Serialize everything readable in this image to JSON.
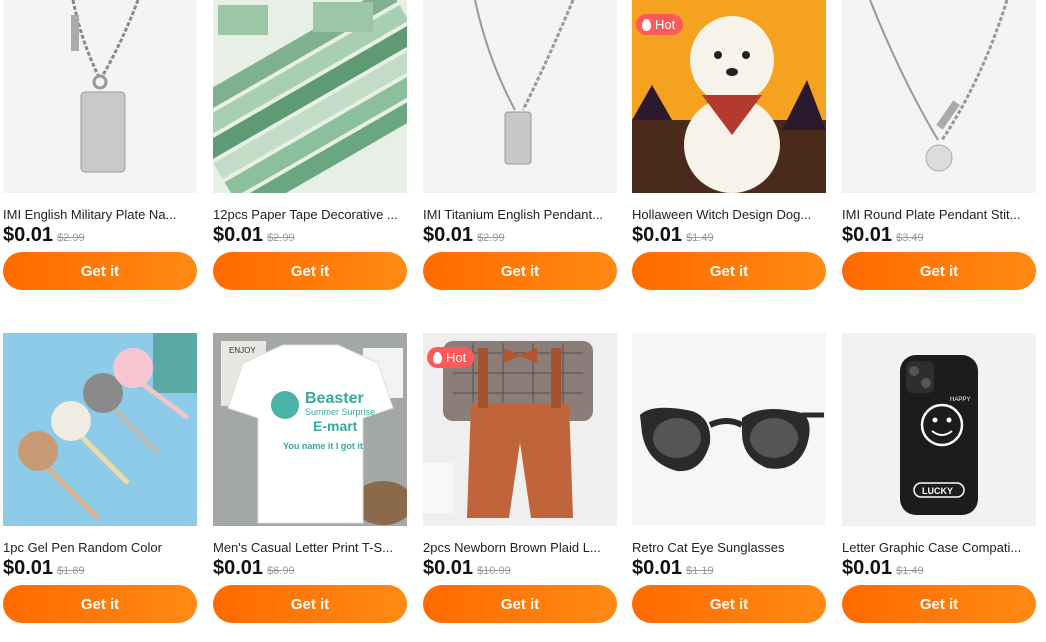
{
  "hot_label": "Hot",
  "products": [
    {
      "title": "IMI English Military Plate Na...",
      "price": "$0.01",
      "original_price": "$2.99",
      "button": "Get it",
      "hot": false,
      "image": "necklace-dog-tag"
    },
    {
      "title": "12pcs Paper Tape Decorative ...",
      "price": "$0.01",
      "original_price": "$2.99",
      "button": "Get it",
      "hot": false,
      "image": "washi-tape"
    },
    {
      "title": "IMI Titanium English Pendant...",
      "price": "$0.01",
      "original_price": "$2.99",
      "button": "Get it",
      "hot": false,
      "image": "necklace-pendant"
    },
    {
      "title": "Hollaween Witch Design Dog...",
      "price": "$0.01",
      "original_price": "$1.49",
      "button": "Get it",
      "hot": true,
      "image": "dog-bandana"
    },
    {
      "title": "IMI Round Plate Pendant Stit...",
      "price": "$0.01",
      "original_price": "$3.49",
      "button": "Get it",
      "hot": false,
      "image": "necklace-round"
    },
    {
      "title": "1pc Gel Pen Random Color",
      "price": "$0.01",
      "original_price": "$1.89",
      "button": "Get it",
      "hot": false,
      "image": "pom-pens"
    },
    {
      "title": "Men's Casual Letter Print T-S...",
      "price": "$0.01",
      "original_price": "$6.99",
      "button": "Get it",
      "hot": false,
      "image": "tshirt"
    },
    {
      "title": "2pcs Newborn Brown Plaid L...",
      "price": "$0.01",
      "original_price": "$10.99",
      "button": "Get it",
      "hot": true,
      "image": "baby-outfit"
    },
    {
      "title": "Retro Cat Eye Sunglasses",
      "price": "$0.01",
      "original_price": "$1.19",
      "button": "Get it",
      "hot": false,
      "image": "sunglasses"
    },
    {
      "title": "Letter Graphic Case Compati...",
      "price": "$0.01",
      "original_price": "$1.49",
      "button": "Get it",
      "hot": false,
      "image": "phone-case"
    }
  ],
  "tshirt_text": {
    "line1": "Beaster",
    "line2": "Summer Surprise",
    "line3": "E-mart",
    "line4": "You name it I got it"
  },
  "phone_case_text": {
    "top": "HAPPY",
    "badge": "LUCKY"
  },
  "tape_card_text": "ENJOY"
}
